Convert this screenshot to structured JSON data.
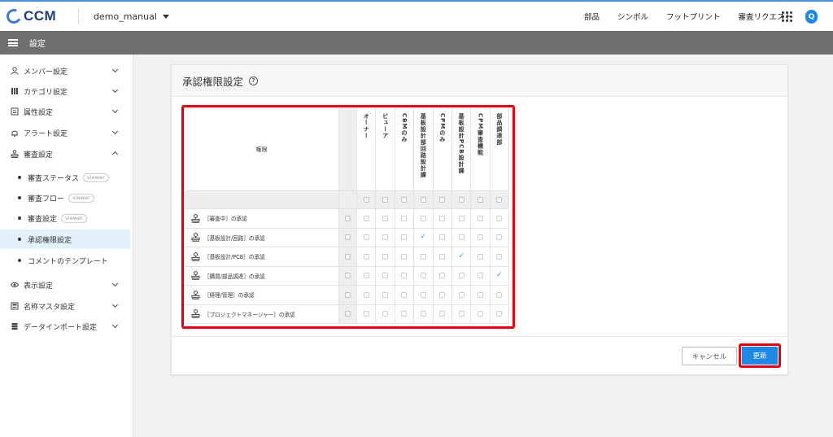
{
  "header": {
    "logo_text": "CCM",
    "project_name": "demo_manual",
    "nav": [
      "部品",
      "シンボル",
      "フットプリント",
      "審査リクエスト"
    ],
    "avatar_initial": "Q"
  },
  "section": {
    "title": "設定"
  },
  "sidebar": {
    "items": [
      {
        "label": "メンバー設定",
        "icon": "person-icon"
      },
      {
        "label": "カテゴリ設定",
        "icon": "category-icon"
      },
      {
        "label": "属性設定",
        "icon": "attribute-icon"
      },
      {
        "label": "アラート設定",
        "icon": "bell-icon"
      },
      {
        "label": "審査設定",
        "icon": "stamp-icon"
      }
    ],
    "subitems": [
      {
        "label": "審査ステータス",
        "badge": "viewer"
      },
      {
        "label": "審査フロー",
        "badge": "viewer"
      },
      {
        "label": "審査設定",
        "badge": "viewer"
      },
      {
        "label": "承認権限設定",
        "badge": ""
      },
      {
        "label": "コメントのテンプレート",
        "badge": ""
      }
    ],
    "items_after": [
      {
        "label": "表示設定",
        "icon": "eye-icon"
      },
      {
        "label": "名称マスタ設定",
        "icon": "master-icon"
      },
      {
        "label": "データインポート設定",
        "icon": "database-icon"
      }
    ]
  },
  "card": {
    "title": "承認権限設定",
    "help_icon": "?",
    "table": {
      "header_label": "権限",
      "columns": [
        "オーナー",
        "ビューア",
        "CBMのみ",
        "基板設計部回路設計課",
        "CPMのみ",
        "基板設計PCB設計課",
        "CPM審査機能",
        "部品調達部"
      ],
      "rows": [
        {
          "label": "［審査中］の承認",
          "checks": [
            false,
            false,
            false,
            false,
            false,
            false,
            false,
            false
          ]
        },
        {
          "label": "［基板設計/回路］の承認",
          "checks": [
            false,
            false,
            false,
            true,
            false,
            false,
            false,
            false
          ]
        },
        {
          "label": "［基板設計/PCB］の承認",
          "checks": [
            false,
            false,
            false,
            false,
            false,
            true,
            false,
            false
          ]
        },
        {
          "label": "［購買/部品調達］の承認",
          "checks": [
            false,
            false,
            false,
            false,
            false,
            false,
            false,
            true
          ]
        },
        {
          "label": "［経理/管理］の承認",
          "checks": [
            false,
            false,
            false,
            false,
            false,
            false,
            false,
            false
          ]
        },
        {
          "label": "［プロジェクトマネージャー］の承認",
          "checks": [
            false,
            false,
            false,
            false,
            false,
            false,
            false,
            false
          ]
        }
      ]
    },
    "cancel_label": "キャンセル",
    "update_label": "更新"
  },
  "colors": {
    "accent": "#1e88e5",
    "highlight": "#e00012",
    "section_bar": "#707070",
    "check": "#2b9be8"
  }
}
